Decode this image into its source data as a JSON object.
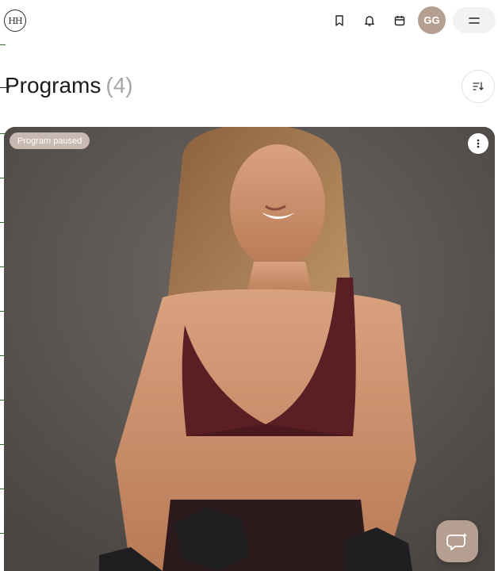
{
  "header": {
    "logo_icon": "brand-monogram-icon",
    "logo_text": "HH",
    "icons": [
      "bookmark-icon",
      "bell-icon",
      "calendar-icon"
    ],
    "avatar_initials": "GG",
    "menu_icon": "hamburger-menu-icon"
  },
  "page": {
    "title": "Programs",
    "count": "(4)",
    "sort_icon": "sort-icon"
  },
  "program_card": {
    "status_badge": "Program paused",
    "more_icon": "more-vertical-icon",
    "image_alt": "Woman in burgundy sports bra holding dumbbells"
  },
  "chat": {
    "icon": "chat-bubble-icon"
  },
  "colors": {
    "accent": "#b59f90",
    "badge_bg": "#dccdc4",
    "count_text": "#a9a49f",
    "card_bg": "#5f5956"
  }
}
